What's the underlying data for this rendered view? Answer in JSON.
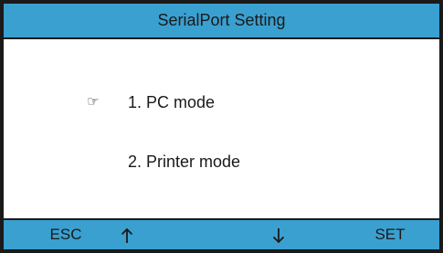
{
  "title": "SerialPort Setting",
  "menu": {
    "pointer_icon": "hand-pointer-icon",
    "selected_index": 0,
    "items": [
      {
        "label": "1. PC mode"
      },
      {
        "label": "2. Printer mode"
      }
    ]
  },
  "softkeys": {
    "esc": "ESC",
    "up_icon": "arrow-up-icon",
    "down_icon": "arrow-down-icon",
    "set": "SET"
  },
  "colors": {
    "bar": "#3aa0d0",
    "border": "#1a1a1a",
    "background": "#ffffff"
  }
}
